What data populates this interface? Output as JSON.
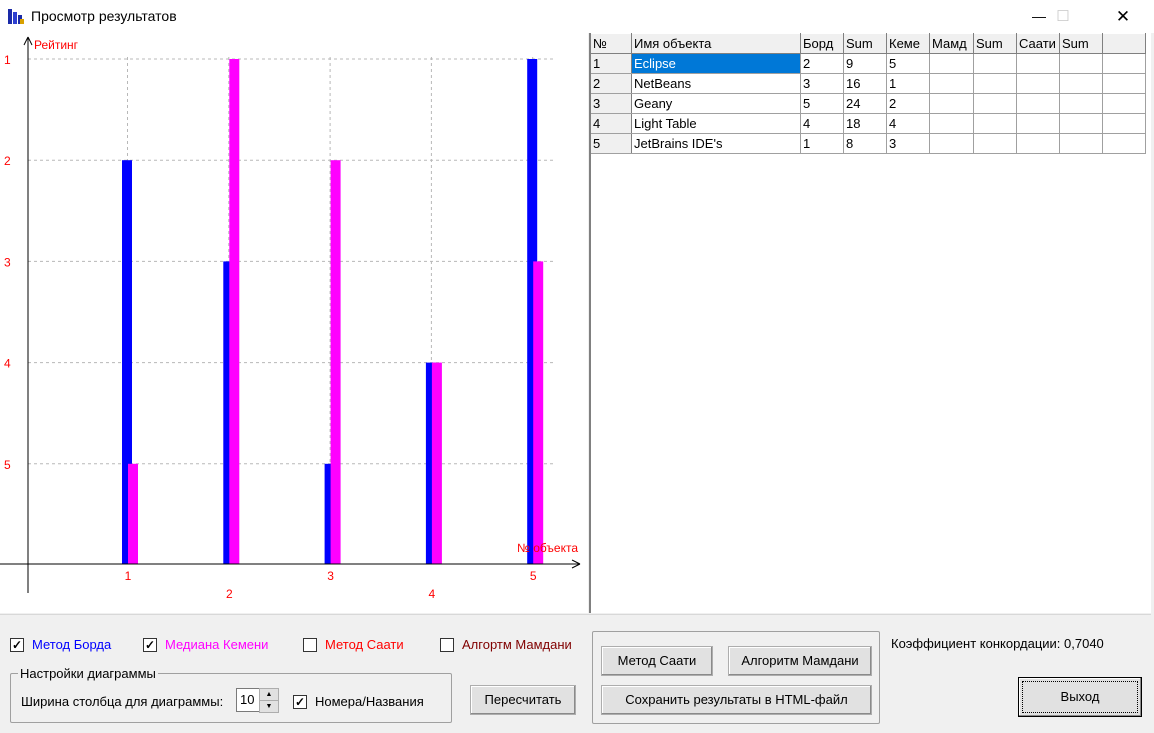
{
  "window": {
    "title": "Просмотр результатов",
    "minimize": "—",
    "maximize": "☐",
    "close": "✕"
  },
  "chart_data": {
    "type": "bar",
    "ylabel": "Рейтинг",
    "xlabel": "№ объекта",
    "categories": [
      "1",
      "2",
      "3",
      "4",
      "5"
    ],
    "y_ticks": [
      "1",
      "2",
      "3",
      "4",
      "5"
    ],
    "ylim": [
      6,
      1
    ],
    "y_inverted": true,
    "series": [
      {
        "name": "Метод Борда",
        "color": "#0000ff",
        "values": [
          2,
          3,
          5,
          4,
          1
        ]
      },
      {
        "name": "Медиана Кемени",
        "color": "#ff00ff",
        "values": [
          5,
          1,
          2,
          4,
          3
        ]
      }
    ],
    "label_color": "#ff0000",
    "grid": true
  },
  "table": {
    "headers": [
      "№",
      "Имя объекта",
      "Борд",
      "Sum",
      "Кеме",
      "Мамд",
      "Sum",
      "Саати",
      "Sum",
      ""
    ],
    "rows": [
      [
        "1",
        "Eclipse",
        "2",
        "9",
        "5",
        "",
        "",
        "",
        "",
        ""
      ],
      [
        "2",
        "NetBeans",
        "3",
        "16",
        "1",
        "",
        "",
        "",
        "",
        ""
      ],
      [
        "3",
        "Geany",
        "5",
        "24",
        "2",
        "",
        "",
        "",
        "",
        ""
      ],
      [
        "4",
        "Light Table",
        "4",
        "18",
        "4",
        "",
        "",
        "",
        "",
        ""
      ],
      [
        "5",
        "JetBrains IDE's",
        "1",
        "8",
        "3",
        "",
        "",
        "",
        "",
        ""
      ]
    ]
  },
  "checkboxes": [
    {
      "label": "Метод Борда",
      "checked": true,
      "color": "#0000ff"
    },
    {
      "label": "Медиана Кемени",
      "checked": true,
      "color": "#ff00ff"
    },
    {
      "label": "Метод Саати",
      "checked": false,
      "color": "#ff0000"
    },
    {
      "label": "Алгортм Мамдани",
      "checked": false,
      "color": "#800000"
    }
  ],
  "settings": {
    "group_title": "Настройки диаграммы",
    "width_label": "Ширина столбца для диаграммы:",
    "width_value": "10",
    "names_label": "Номера/Названия",
    "names_checked": true
  },
  "buttons": {
    "recalc": "Пересчитать",
    "saaty": "Метод Саати",
    "mamdani": "Алгоритм Мамдани",
    "save_html": "Сохранить результаты в HTML-файл",
    "exit": "Выход"
  },
  "concordance": "Коэффициент конкордации: 0,7040"
}
